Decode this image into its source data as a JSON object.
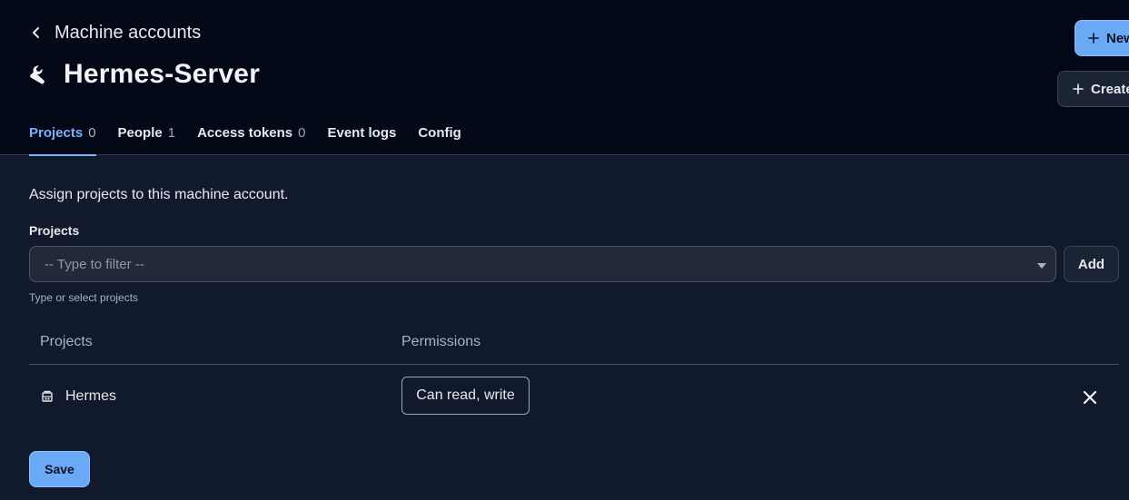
{
  "header": {
    "back_label": "Machine accounts",
    "title": "Hermes-Server",
    "title_icon": "wrench-icon",
    "new_button": "New",
    "create_button": "Create"
  },
  "tabs": [
    {
      "label": "Projects",
      "count": "0",
      "active": true
    },
    {
      "label": "People",
      "count": "1"
    },
    {
      "label": "Access tokens",
      "count": "0"
    },
    {
      "label": "Event logs",
      "count": ""
    },
    {
      "label": "Config",
      "count": ""
    }
  ],
  "assign": {
    "intro": "Assign projects to this machine account.",
    "field_label": "Projects",
    "filter_placeholder": "-- Type to filter --",
    "add_button": "Add",
    "hint": "Type or select projects"
  },
  "table": {
    "columns": [
      "Projects",
      "Permissions"
    ],
    "rows": [
      {
        "project": "Hermes",
        "permission": "Can read, write"
      }
    ]
  },
  "footer": {
    "save_button": "Save"
  },
  "colors": {
    "header_bg": "#030817",
    "page_bg": "#111a2c",
    "accent": "#79b2ff",
    "primary_button": "#6aa9f6"
  }
}
